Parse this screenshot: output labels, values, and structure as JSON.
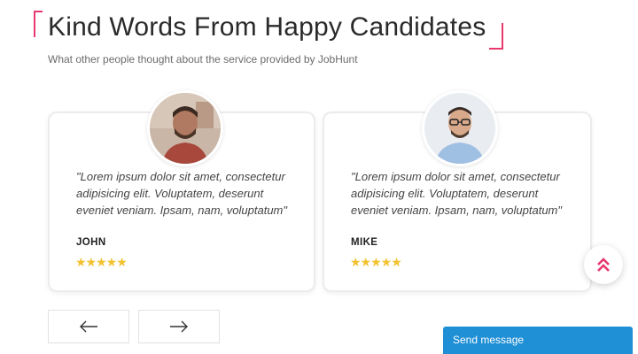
{
  "header": {
    "title": "Kind Words From Happy Candidates",
    "subtitle": "What other people thought about the service provided by JobHunt"
  },
  "testimonials": [
    {
      "quote": "\"Lorem ipsum dolor sit amet, consectetur adipisicing elit. Voluptatem, deserunt eveniet veniam. Ipsam, nam, voluptatum\"",
      "name": "JOHN",
      "rating": 5,
      "stars": "★★★★★"
    },
    {
      "quote": "\"Lorem ipsum dolor sit amet, consectetur adipisicing elit. Voluptatem, deserunt eveniet veniam. Ipsam, nam, voluptatum\"",
      "name": "MIKE",
      "rating": 5,
      "stars": "★★★★★"
    }
  ],
  "nav": {
    "prev_icon": "arrow-left-icon",
    "next_icon": "arrow-right-icon"
  },
  "scroll_top": {
    "icon": "double-chevron-up-icon"
  },
  "chat": {
    "label": "Send message"
  },
  "colors": {
    "accent": "#e8386d",
    "star": "#f2c230",
    "chat_bg": "#1f8fd6"
  }
}
